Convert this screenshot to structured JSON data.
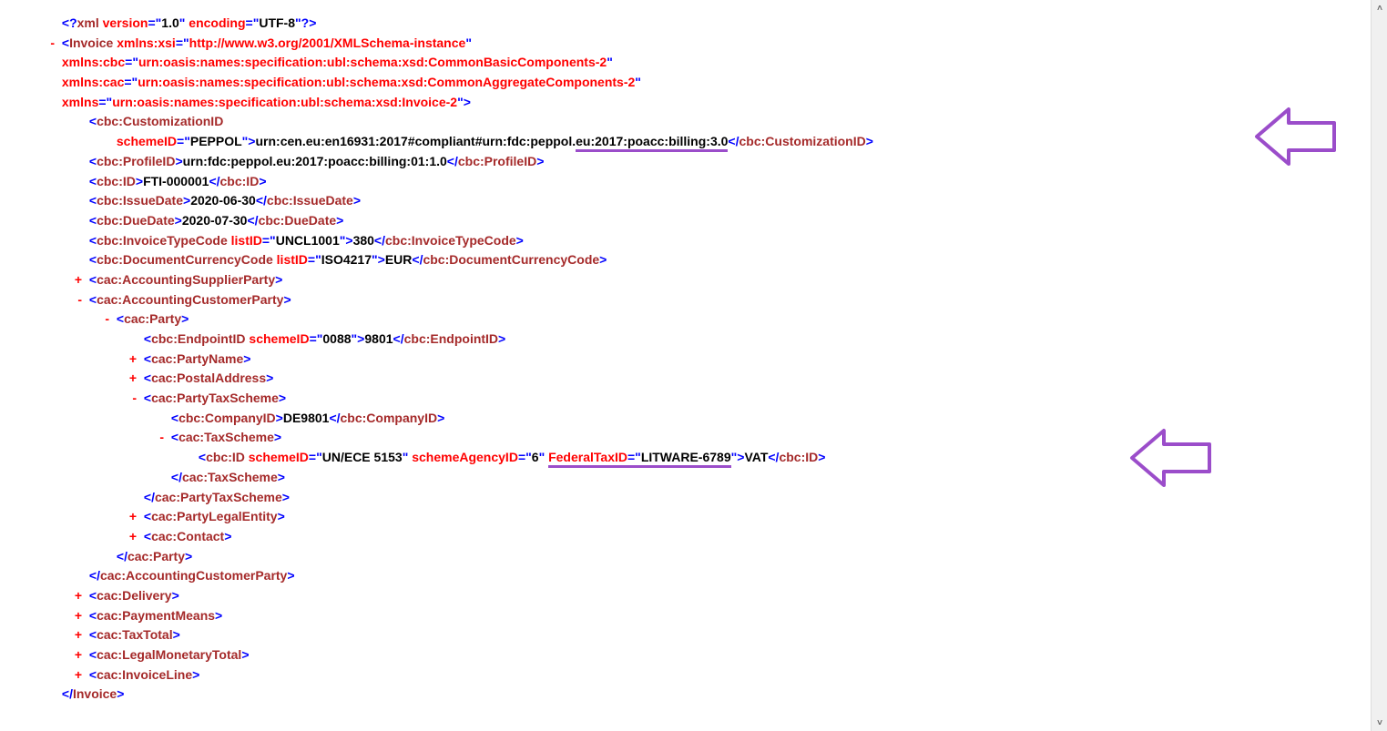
{
  "xml_decl": {
    "open": "<?",
    "name": "xml",
    "version_attr": "version",
    "version_val": "1.0",
    "encoding_attr": "encoding",
    "encoding_val": "UTF-8",
    "close": "?>"
  },
  "invoice": {
    "toggle": "-",
    "open_lt": "<",
    "name": "Invoice",
    "attrs": {
      "xsi_attr": "xmlns:xsi",
      "xsi_val": "http://www.w3.org/2001/XMLSchema-instance",
      "cbc_attr": "xmlns:cbc",
      "cbc_val": "urn:oasis:names:specification:ubl:schema:xsd:CommonBasicComponents-2",
      "cac_attr": "xmlns:cac",
      "cac_val": "urn:oasis:names:specification:ubl:schema:xsd:CommonAggregateComponents-2",
      "xmlns_attr": "xmlns",
      "xmlns_val": "urn:oasis:names:specification:ubl:schema:xsd:Invoice-2"
    },
    "close_tag": "</Invoice>"
  },
  "customization": {
    "open": "<cbc:CustomizationID",
    "schemeID_attr": "schemeID",
    "schemeID_val": "PEPPOL",
    "text_a": "urn:cen.eu:en16931:2017#compliant#urn:fdc:peppol.",
    "text_b": "eu:2017:poacc:billing:3.0",
    "close": "</cbc:CustomizationID>"
  },
  "profile": {
    "open": "<cbc:ProfileID>",
    "text": "urn:fdc:peppol.eu:2017:poacc:billing:01:1.0",
    "close": "</cbc:ProfileID>"
  },
  "id": {
    "open": "<cbc:ID>",
    "text": "FTI-000001",
    "close": "</cbc:ID>"
  },
  "issue": {
    "open": "<cbc:IssueDate>",
    "text": "2020-06-30",
    "close": "</cbc:IssueDate>"
  },
  "due": {
    "open": "<cbc:DueDate>",
    "text": "2020-07-30",
    "close": "</cbc:DueDate>"
  },
  "typecode": {
    "open": "<cbc:InvoiceTypeCode",
    "listID_attr": "listID",
    "listID_val": "UNCL1001",
    "text": "380",
    "close": "</cbc:InvoiceTypeCode>"
  },
  "currency": {
    "open": "<cbc:DocumentCurrencyCode",
    "listID_attr": "listID",
    "listID_val": "ISO4217",
    "text": "EUR",
    "close": "</cbc:DocumentCurrencyCode>"
  },
  "supplier": {
    "toggle": "+",
    "tag": "<cac:AccountingSupplierParty>"
  },
  "customer": {
    "toggle": "-",
    "open": "<cac:AccountingCustomerParty>",
    "close": "</cac:AccountingCustomerParty>"
  },
  "party": {
    "toggle": "-",
    "open": "<cac:Party>",
    "close": "</cac:Party>"
  },
  "endpoint": {
    "open": "<cbc:EndpointID",
    "schemeID_attr": "schemeID",
    "schemeID_val": "0088",
    "text": "9801",
    "close": "</cbc:EndpointID>"
  },
  "partyname": {
    "toggle": "+",
    "tag": "<cac:PartyName>"
  },
  "postal": {
    "toggle": "+",
    "tag": "<cac:PostalAddress>"
  },
  "partytax": {
    "toggle": "-",
    "open": "<cac:PartyTaxScheme>",
    "close": "</cac:PartyTaxScheme>"
  },
  "companyid": {
    "open": "<cbc:CompanyID>",
    "text": "DE9801",
    "close": "</cbc:CompanyID>"
  },
  "taxscheme": {
    "toggle": "-",
    "open": "<cac:TaxScheme>",
    "close": "</cac:TaxScheme>"
  },
  "taxid": {
    "open": "<cbc:ID",
    "schemeID_attr": "schemeID",
    "schemeID_val": "UN/ECE 5153",
    "agency_attr": "schemeAgencyID",
    "agency_val": "6",
    "fedtax_attr": "FederalTaxID",
    "fedtax_val": "LITWARE-6789",
    "text": "VAT",
    "close": "</cbc:ID>"
  },
  "legalentity": {
    "toggle": "+",
    "tag": "<cac:PartyLegalEntity>"
  },
  "contact": {
    "toggle": "+",
    "tag": "<cac:Contact>"
  },
  "delivery": {
    "toggle": "+",
    "tag": "<cac:Delivery>"
  },
  "payment": {
    "toggle": "+",
    "tag": "<cac:PaymentMeans>"
  },
  "taxtotal": {
    "toggle": "+",
    "tag": "<cac:TaxTotal>"
  },
  "monetary": {
    "toggle": "+",
    "tag": "<cac:LegalMonetaryTotal>"
  },
  "invoiceline": {
    "toggle": "+",
    "tag": "<cac:InvoiceLine>"
  },
  "scroll": {
    "up": "˄",
    "down": "˅"
  }
}
